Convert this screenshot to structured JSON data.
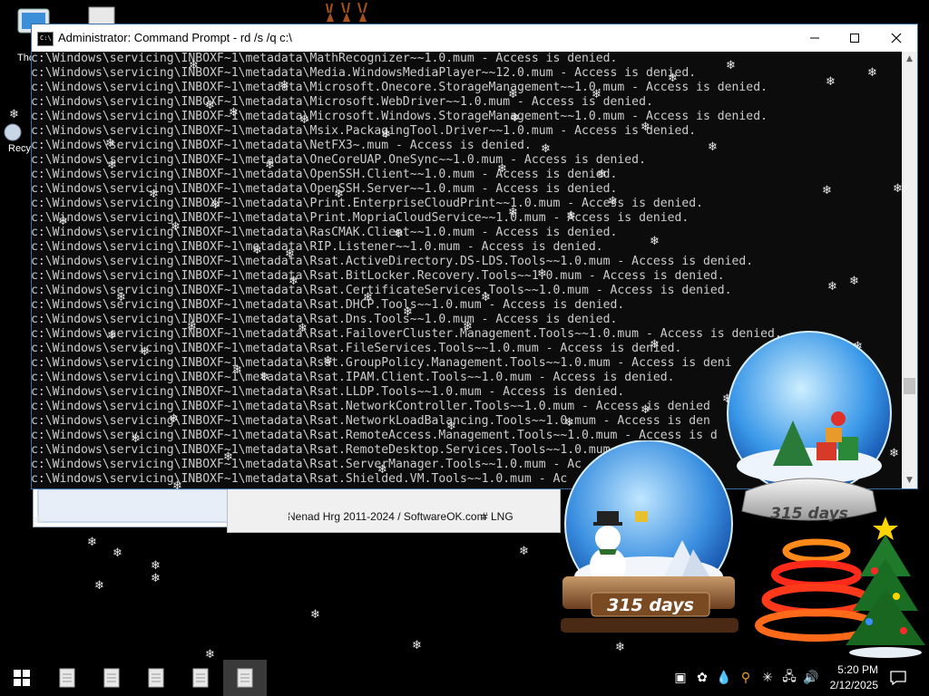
{
  "window": {
    "title": "Administrator: Command Prompt - rd  /s /q c:\\",
    "minimize_glyph": "—",
    "maximize_glyph": "□",
    "close_glyph": "✕"
  },
  "console_lines": [
    "c:\\Windows\\servicing\\INBOXF~1\\metadata\\MathRecognizer~~1.0.mum - Access is denied.",
    "c:\\Windows\\servicing\\INBOXF~1\\metadata\\Media.WindowsMediaPlayer~~12.0.mum - Access is denied.",
    "c:\\Windows\\servicing\\INBOXF~1\\metadata\\Microsoft.Onecore.StorageManagement~~1.0.mum - Access is denied.",
    "c:\\Windows\\servicing\\INBOXF~1\\metadata\\Microsoft.WebDriver~~1.0.mum - Access is denied.",
    "c:\\Windows\\servicing\\INBOXF~1\\metadata\\Microsoft.Windows.StorageManagement~~1.0.mum - Access is denied.",
    "c:\\Windows\\servicing\\INBOXF~1\\metadata\\Msix.PackagingTool.Driver~~1.0.mum - Access is denied.",
    "c:\\Windows\\servicing\\INBOXF~1\\metadata\\NetFX3~.mum - Access is denied.",
    "c:\\Windows\\servicing\\INBOXF~1\\metadata\\OneCoreUAP.OneSync~~1.0.mum - Access is denied.",
    "c:\\Windows\\servicing\\INBOXF~1\\metadata\\OpenSSH.Client~~1.0.mum - Access is denied.",
    "c:\\Windows\\servicing\\INBOXF~1\\metadata\\OpenSSH.Server~~1.0.mum - Access is denied.",
    "c:\\Windows\\servicing\\INBOXF~1\\metadata\\Print.EnterpriseCloudPrint~~1.0.mum - Access is denied.",
    "c:\\Windows\\servicing\\INBOXF~1\\metadata\\Print.MopriaCloudService~~1.0.mum - Access is denied.",
    "c:\\Windows\\servicing\\INBOXF~1\\metadata\\RasCMAK.Client~~1.0.mum - Access is denied.",
    "c:\\Windows\\servicing\\INBOXF~1\\metadata\\RIP.Listener~~1.0.mum - Access is denied.",
    "c:\\Windows\\servicing\\INBOXF~1\\metadata\\Rsat.ActiveDirectory.DS-LDS.Tools~~1.0.mum - Access is denied.",
    "c:\\Windows\\servicing\\INBOXF~1\\metadata\\Rsat.BitLocker.Recovery.Tools~~1.0.mum - Access is denied.",
    "c:\\Windows\\servicing\\INBOXF~1\\metadata\\Rsat.CertificateServices.Tools~~1.0.mum - Access is denied.",
    "c:\\Windows\\servicing\\INBOXF~1\\metadata\\Rsat.DHCP.Tools~~1.0.mum - Access is denied.",
    "c:\\Windows\\servicing\\INBOXF~1\\metadata\\Rsat.Dns.Tools~~1.0.mum - Access is denied.",
    "c:\\Windows\\servicing\\INBOXF~1\\metadata\\Rsat.FailoverCluster.Management.Tools~~1.0.mum - Access is denied.",
    "c:\\Windows\\servicing\\INBOXF~1\\metadata\\Rsat.FileServices.Tools~~1.0.mum - Access is denied.",
    "c:\\Windows\\servicing\\INBOXF~1\\metadata\\Rsat.GroupPolicy.Management.Tools~~1.0.mum - Access is deni",
    "c:\\Windows\\servicing\\INBOXF~1\\metadata\\Rsat.IPAM.Client.Tools~~1.0.mum - Access is denied.",
    "c:\\Windows\\servicing\\INBOXF~1\\metadata\\Rsat.LLDP.Tools~~1.0.mum - Access is denied.",
    "c:\\Windows\\servicing\\INBOXF~1\\metadata\\Rsat.NetworkController.Tools~~1.0.mum - Access is denied",
    "c:\\Windows\\servicing\\INBOXF~1\\metadata\\Rsat.NetworkLoadBalancing.Tools~~1.0.mum - Access is den",
    "c:\\Windows\\servicing\\INBOXF~1\\metadata\\Rsat.RemoteAccess.Management.Tools~~1.0.mum - Access is d",
    "c:\\Windows\\servicing\\INBOXF~1\\metadata\\Rsat.RemoteDesktop.Services.Tools~~1.0.mum",
    "c:\\Windows\\servicing\\INBOXF~1\\metadata\\Rsat.ServerManager.Tools~~1.0.mum - Ac",
    "c:\\Windows\\servicing\\INBOXF~1\\metadata\\Rsat.Shielded.VM.Tools~~1.0.mum - Ac"
  ],
  "desktop": {
    "icon1_label": "Thc",
    "icon2_label": "Recy"
  },
  "background_app": {
    "credit": "Nenad Hrg 2011-2024 / SoftwareOK.com",
    "lng": "# LNG"
  },
  "globes": {
    "left_days": "315 days",
    "right_days": "315 days"
  },
  "taskbar": {
    "time": "5:20 PM",
    "date": "2/12/2025"
  },
  "colors": {
    "console_bg": "#0c0c0c",
    "console_text": "#cccccc",
    "taskbar_bg": "#000000"
  }
}
